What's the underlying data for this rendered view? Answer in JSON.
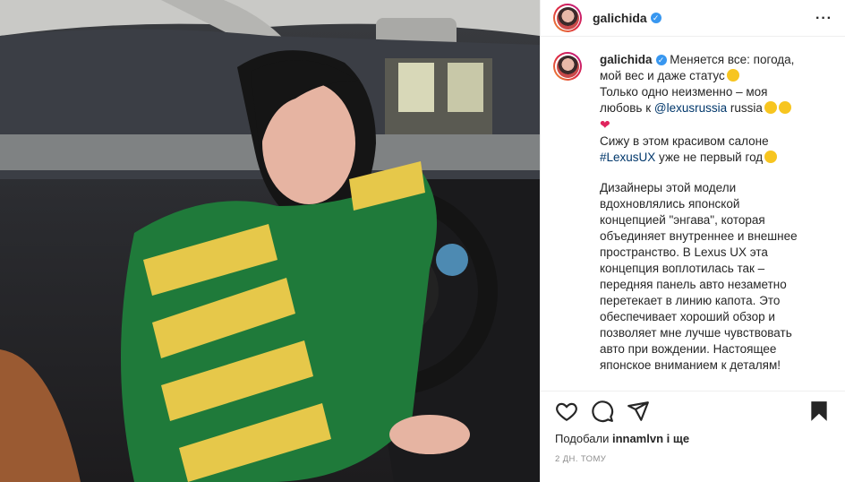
{
  "post": {
    "username": "galichida",
    "verified_icon": "verified-badge-icon",
    "more_icon": "more-options-icon",
    "photo_description_icon": "post-photo",
    "caption": {
      "line1": "Меняется все: погода,",
      "line2": "мой вес и даже статус",
      "line3": "Только одно неизменно – моя",
      "line4a": "любовь к ",
      "mention": "@lexusrussia",
      "line4b": " russia",
      "line5": "Сижу в этом красивом салоне",
      "hashtag": "#LexusUX",
      "line6b": " уже не первый год",
      "p2_lines": [
        "Дизайнеры этой модели",
        "вдохновлялись японской",
        "концепцией \"энгава\", которая",
        "объединяет внутреннее и внешнее",
        "пространство. В Lexus UX эта",
        "концепция воплотилась так –",
        "передняя панель авто незаметно",
        "перетекает в линию капота. Это",
        "обеспечивает хороший обзор и",
        "позволяет мне лучше чувствовать",
        "авто при вождении. Настоящее",
        "японское вниманием к деталям!"
      ]
    },
    "likes": {
      "prefix": "Подобали ",
      "user": "innamlvn",
      "suffix": " і ще"
    },
    "time": "2 дн. тому",
    "icons": [
      "heart-icon",
      "comment-icon",
      "share-icon",
      "bookmark-icon"
    ]
  }
}
